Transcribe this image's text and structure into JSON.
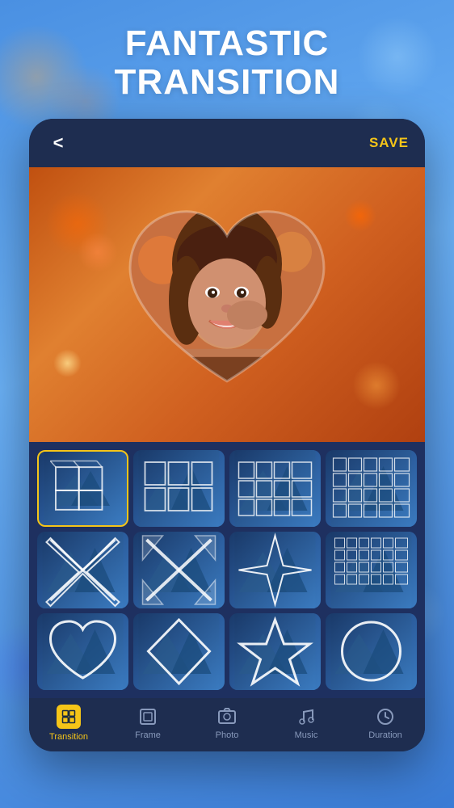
{
  "title": {
    "line1": "FANTASTIC",
    "line2": "TRANSITION"
  },
  "header": {
    "back_label": "<",
    "save_label": "SAVE"
  },
  "transition_grid": {
    "items": [
      {
        "id": 1,
        "type": "cube",
        "active": true
      },
      {
        "id": 2,
        "type": "grid3x2"
      },
      {
        "id": 3,
        "type": "grid4x3"
      },
      {
        "id": 4,
        "type": "grid5x3"
      },
      {
        "id": 5,
        "type": "x-cross"
      },
      {
        "id": 6,
        "type": "x-cross2"
      },
      {
        "id": 7,
        "type": "star"
      },
      {
        "id": 8,
        "type": "grid-small"
      },
      {
        "id": 9,
        "type": "heart"
      },
      {
        "id": 10,
        "type": "triangle"
      },
      {
        "id": 11,
        "type": "star5"
      },
      {
        "id": 12,
        "type": "circle"
      }
    ]
  },
  "bottom_nav": {
    "items": [
      {
        "id": "transition",
        "label": "Transition",
        "active": true
      },
      {
        "id": "frame",
        "label": "Frame",
        "active": false
      },
      {
        "id": "photo",
        "label": "Photo",
        "active": false
      },
      {
        "id": "music",
        "label": "Music",
        "active": false
      },
      {
        "id": "duration",
        "label": "Duration",
        "active": false
      }
    ]
  }
}
